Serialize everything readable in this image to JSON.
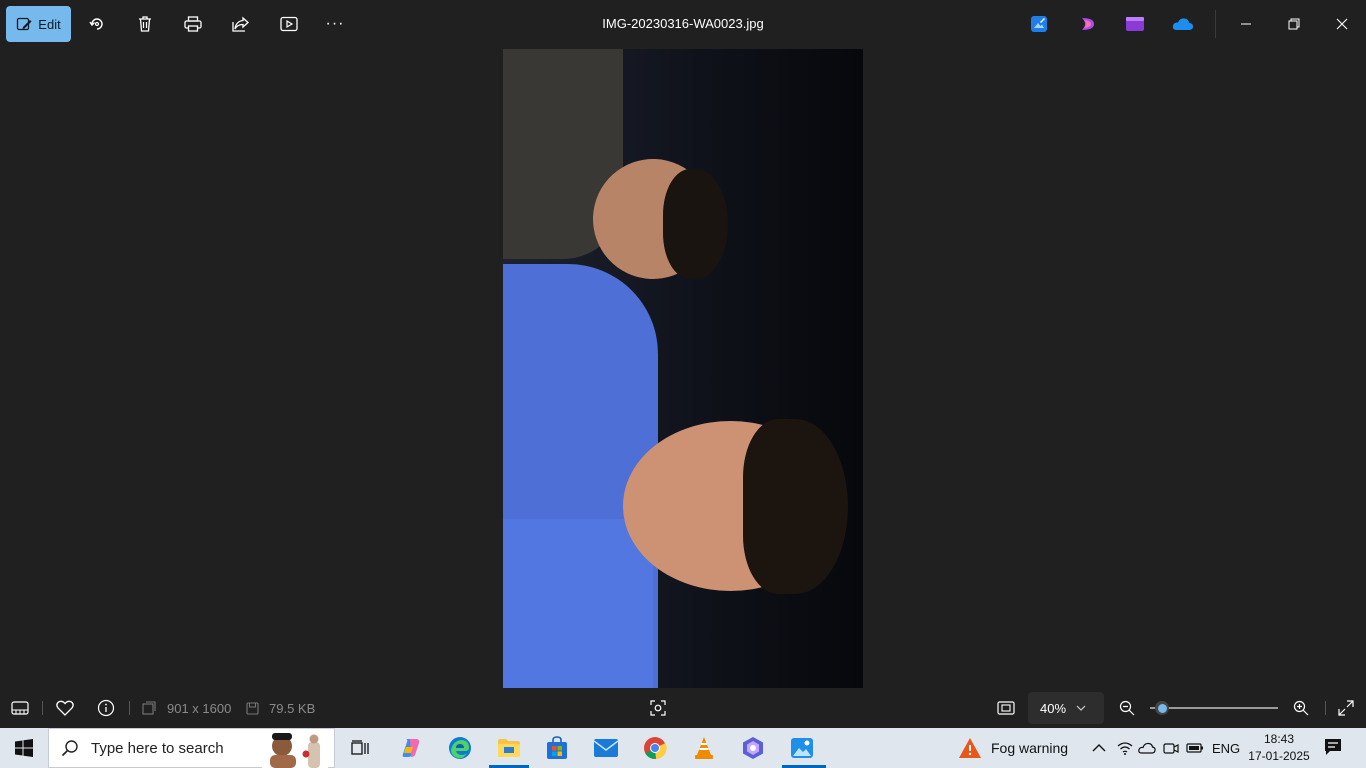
{
  "toolbar": {
    "edit_label": "Edit",
    "file_name": "IMG-20230316-WA0023.jpg",
    "tools": [
      "rotate-icon",
      "delete-icon",
      "print-icon",
      "share-icon",
      "slideshow-icon",
      "more-icon"
    ],
    "more_label": "···"
  },
  "status": {
    "dimensions": "901 x 1600",
    "file_size": "79.5 KB",
    "zoom": "40%",
    "zoom_level_fraction": 0.04
  },
  "taskbar": {
    "search_placeholder": "Type here to search",
    "weather": "Fog warning",
    "language": "ENG",
    "time": "18:43",
    "date": "17-01-2025"
  },
  "colors": {
    "accent": "#76b9ed",
    "background": "#202020",
    "taskbar": "#dfe6ee"
  }
}
